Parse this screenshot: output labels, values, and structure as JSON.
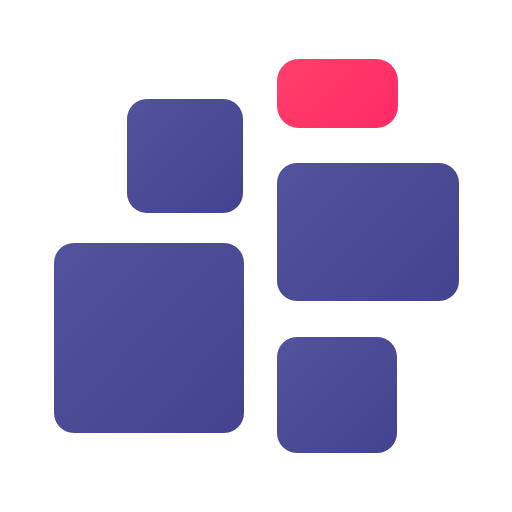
{
  "logo": {
    "icon": "tiles-logo-icon",
    "colors": {
      "primary_light": "#53529c",
      "primary_dark": "#43438f",
      "accent_light": "#ff3f6a",
      "accent_dark": "#ff2a66"
    }
  }
}
